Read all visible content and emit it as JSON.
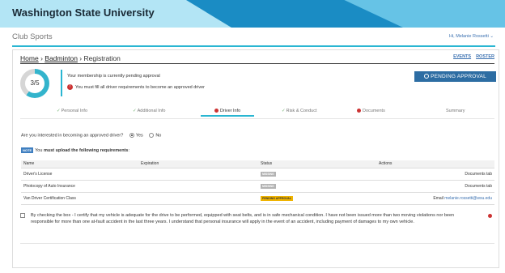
{
  "header": {
    "title": "Washington State University"
  },
  "clubbar": {
    "name": "Club Sports",
    "user": "Hi, Melanie Rossetti"
  },
  "breadcrumb": {
    "home": "Home",
    "sep": "›",
    "sport": "Badminton",
    "current": "Registration"
  },
  "top_links": {
    "events": "EVENTS",
    "roster": "ROSTER"
  },
  "progress": {
    "label": "3/5",
    "fraction": 0.6
  },
  "status": {
    "message": "Your membership is currently pending approval",
    "warning": "You must fill all driver requirements to become an approved driver",
    "button": "PENDING APPROVAL"
  },
  "tabs": [
    {
      "label": "Personal Info",
      "state": "done"
    },
    {
      "label": "Additional Info",
      "state": "done"
    },
    {
      "label": "Driver Info",
      "state": "error"
    },
    {
      "label": "Risk & Conduct",
      "state": "done"
    },
    {
      "label": "Documents",
      "state": "error"
    },
    {
      "label": "Summary",
      "state": "none"
    }
  ],
  "driver_question": {
    "text": "Are you interested in becoming an approved driver?",
    "yes": "Yes",
    "no": "No"
  },
  "note": {
    "tag": "NOTE",
    "prefix": "You ",
    "bold": "must upload the following requirements",
    "suffix": ":"
  },
  "table": {
    "headers": [
      "Name",
      "Expiration",
      "Status",
      "Actions"
    ],
    "rows": [
      {
        "name": "Driver's License",
        "expiration": "",
        "status": "MISSING",
        "action_prefix": "",
        "action": "Documents tab"
      },
      {
        "name": "Photocopy of Auto Insurance",
        "expiration": "",
        "status": "MISSING",
        "action_prefix": "",
        "action": "Documents tab"
      },
      {
        "name": "Van Driver Certification Class",
        "expiration": "",
        "status": "PENDING APPROVAL",
        "action_prefix": "Email ",
        "action": "melanie.rossetti@wsu.edu"
      }
    ]
  },
  "certify": "By checking the box - I certify that my vehicle is adequate for the drive to be performed, equipped with seat belts, and is in safe mechanical condition. I have not been issued more than two moving violations nor been responsible for more than one at-fault accident in the last three years. I understand that personal insurance will apply in the event of an accident, including payment of damages to my own vehicle."
}
